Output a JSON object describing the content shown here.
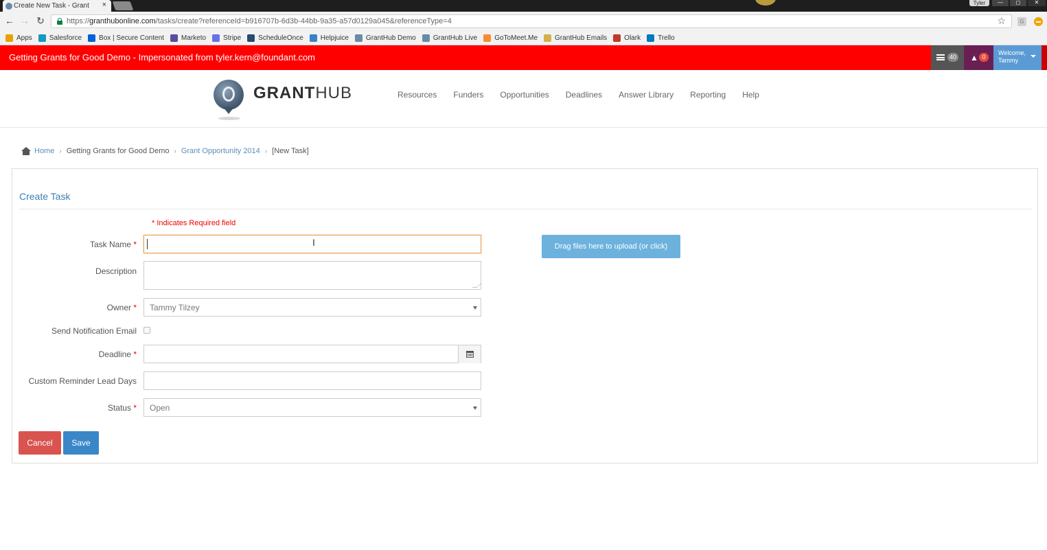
{
  "browser": {
    "tab_title": "Create New Task - Grant",
    "tab_close": "×",
    "user_label": "Tyler",
    "window_min": "—",
    "window_max": "◻",
    "window_close": "✕",
    "url_scheme": "https://",
    "url_host": "granthubonline.com",
    "url_path": "/tasks/create?referenceId=b916707b-6d3b-44bb-9a35-a57d0129a045&referenceType=4",
    "back": "←",
    "forward": "→",
    "reload": "↻",
    "star": "☆",
    "bookmarks": [
      {
        "label": "Apps",
        "color": "#e5a200",
        "icon": "apps-grid-icon"
      },
      {
        "label": "Salesforce",
        "color": "#1798c1",
        "icon": "salesforce-icon"
      },
      {
        "label": "Box | Secure Content",
        "color": "#0061d5",
        "icon": "box-icon"
      },
      {
        "label": "Marketo",
        "color": "#5c4c9f",
        "icon": "marketo-icon"
      },
      {
        "label": "Stripe",
        "color": "#6772e5",
        "icon": "stripe-icon"
      },
      {
        "label": "ScheduleOnce",
        "color": "#2a4a6e",
        "icon": "scheduleonce-icon"
      },
      {
        "label": "Helpjuice",
        "color": "#3b82c4",
        "icon": "helpjuice-icon"
      },
      {
        "label": "GrantHub Demo",
        "color": "#6a8aa8",
        "icon": "granthub-icon"
      },
      {
        "label": "GrantHub Live",
        "color": "#6a8aa8",
        "icon": "granthub-icon"
      },
      {
        "label": "GoToMeet.Me",
        "color": "#f68d2e",
        "icon": "gotomeeting-icon"
      },
      {
        "label": "GrantHub Emails",
        "color": "#d4b04a",
        "icon": "email-icon"
      },
      {
        "label": "Olark",
        "color": "#c0392b",
        "icon": "olark-icon"
      },
      {
        "label": "Trello",
        "color": "#0079bf",
        "icon": "trello-icon"
      }
    ]
  },
  "banner": {
    "text": "Getting Grants for Good Demo - Impersonated from tyler.kern@foundant.com",
    "messages_count": "40",
    "notifications_count": "0",
    "welcome_line1": "Welcome,",
    "welcome_line2": "Tammy",
    "bell": "🔔"
  },
  "header": {
    "logo_bold": "GRANT",
    "logo_light": "HUB",
    "nav": [
      "Resources",
      "Funders",
      "Opportunities",
      "Deadlines",
      "Answer Library",
      "Reporting",
      "Help"
    ]
  },
  "breadcrumb": {
    "home": "Home",
    "org": "Getting Grants for Good Demo",
    "opportunity": "Grant Opportunity 2014",
    "current": "[New Task]",
    "sep": "›"
  },
  "form": {
    "title": "Create Task",
    "required_note": "* Indicates Required field",
    "star": "*",
    "labels": {
      "task_name": "Task Name",
      "description": "Description",
      "owner": "Owner",
      "send_notification": "Send Notification Email",
      "deadline": "Deadline",
      "reminder": "Custom Reminder Lead Days",
      "status": "Status"
    },
    "values": {
      "task_name": "",
      "description": "",
      "owner": "Tammy Tilzey",
      "deadline": "",
      "reminder": "",
      "status": "Open",
      "send_notification": false
    },
    "upload_label": "Drag files here to upload (or click)",
    "cancel_label": "Cancel",
    "save_label": "Save"
  },
  "colors": {
    "banner_red": "#ff0000",
    "link_blue": "#3c7fb5",
    "cancel_red": "#d9534f",
    "save_blue": "#3a87c8",
    "upload_blue": "#6cb2dd",
    "required_red": "#ee0000"
  }
}
